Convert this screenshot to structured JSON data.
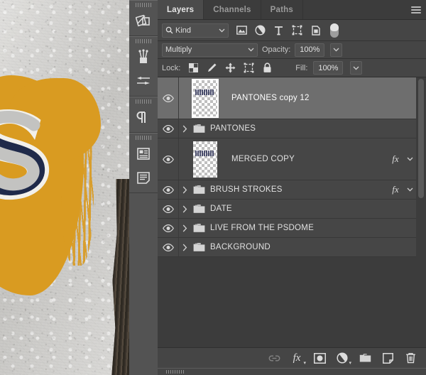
{
  "panel": {
    "tabs": [
      {
        "label": "Layers",
        "active": true
      },
      {
        "label": "Channels",
        "active": false
      },
      {
        "label": "Paths",
        "active": false
      }
    ],
    "menu_icon": "hamburger-menu-icon"
  },
  "filter_row": {
    "search_icon": "search-icon",
    "kind_label": "Kind",
    "kind_chevron": "chevron-down-icon",
    "icons": [
      {
        "name": "filter-pixel-icon"
      },
      {
        "name": "filter-adjustment-icon"
      },
      {
        "name": "filter-type-icon"
      },
      {
        "name": "filter-shape-icon"
      },
      {
        "name": "filter-smart-object-icon"
      }
    ],
    "toggle": {
      "name": "filter-enable-toggle",
      "state": "on"
    }
  },
  "blend_row": {
    "blend_mode": "Multiply",
    "blend_chevron": "chevron-down-icon",
    "opacity_label": "Opacity:",
    "opacity_value": "100%",
    "opacity_stepper": "chevron-down-icon"
  },
  "lock_row": {
    "lock_label": "Lock:",
    "lock_icons": [
      {
        "name": "lock-transparency-icon"
      },
      {
        "name": "lock-image-pixels-icon"
      },
      {
        "name": "lock-position-icon"
      },
      {
        "name": "lock-artboard-nesting-icon"
      },
      {
        "name": "lock-all-icon"
      }
    ],
    "fill_label": "Fill:",
    "fill_value": "100%",
    "fill_stepper": "chevron-down-icon"
  },
  "layers": [
    {
      "name": "PANTONES copy 12",
      "type": "layer",
      "visible": true,
      "selected": true,
      "has_thumb": true,
      "has_group_disclosure": false,
      "has_fx": false,
      "height": "tall"
    },
    {
      "name": "PANTONES",
      "type": "group",
      "visible": true,
      "selected": false,
      "has_thumb": false,
      "has_group_disclosure": true,
      "has_fx": false,
      "height": "short"
    },
    {
      "name": "MERGED COPY",
      "type": "layer",
      "visible": true,
      "selected": false,
      "has_thumb": true,
      "has_group_disclosure": false,
      "has_fx": true,
      "height": "tall"
    },
    {
      "name": "BRUSH STROKES",
      "type": "group",
      "visible": true,
      "selected": false,
      "has_thumb": false,
      "has_group_disclosure": true,
      "has_fx": true,
      "height": "short"
    },
    {
      "name": "DATE",
      "type": "group",
      "visible": true,
      "selected": false,
      "has_thumb": false,
      "has_group_disclosure": true,
      "has_fx": false,
      "height": "short"
    },
    {
      "name": "LIVE FROM THE PSDOME",
      "type": "group",
      "visible": true,
      "selected": false,
      "has_thumb": false,
      "has_group_disclosure": true,
      "has_fx": false,
      "height": "short"
    },
    {
      "name": "BACKGROUND",
      "type": "group",
      "visible": true,
      "selected": false,
      "has_thumb": false,
      "has_group_disclosure": true,
      "has_fx": false,
      "height": "short"
    }
  ],
  "bottom_toolbar": [
    {
      "name": "link-layers-button",
      "icon": "link-icon",
      "enabled": false
    },
    {
      "name": "layer-style-button",
      "icon": "fx-icon",
      "enabled": true
    },
    {
      "name": "add-layer-mask-button",
      "icon": "mask-icon",
      "enabled": true
    },
    {
      "name": "new-adjustment-layer-button",
      "icon": "adjustment-half-circle-icon",
      "enabled": true
    },
    {
      "name": "new-group-button",
      "icon": "folder-icon",
      "enabled": true
    },
    {
      "name": "new-layer-button",
      "icon": "new-layer-icon",
      "enabled": true
    },
    {
      "name": "delete-layer-button",
      "icon": "trash-icon",
      "enabled": true
    }
  ],
  "icon_rail": [
    {
      "name": "swatches-color-icon"
    },
    {
      "name": "brushes-icon"
    },
    {
      "name": "brush-settings-icon"
    },
    {
      "name": "paragraph-icon"
    },
    {
      "name": "character-styles-icon"
    },
    {
      "name": "paragraph-styles-icon"
    }
  ],
  "colors": {
    "panel_bg": "#3c3c3c",
    "row_bg": "#464646",
    "row_selected_bg": "#6e6e6e",
    "chrome_bg": "#454545",
    "text": "#e0e0e0",
    "text_muted": "#9a9a9a",
    "brand_gold": "#d99b21",
    "brand_navy": "#1f2a4a"
  }
}
